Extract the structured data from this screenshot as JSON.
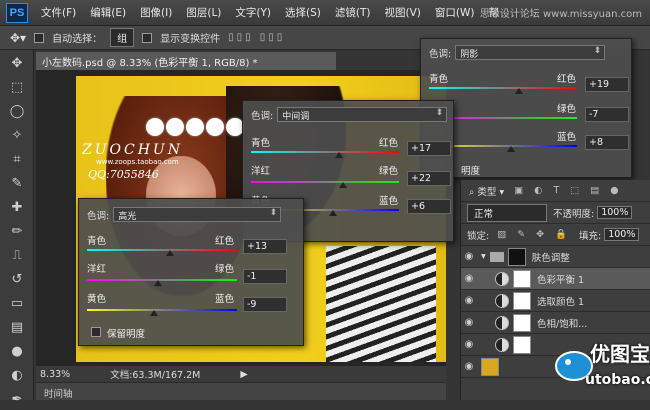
{
  "app": {
    "logo": "PS",
    "watermark_top": "思缘设计论坛 www.missyuan.com"
  },
  "menu": [
    "文件(F)",
    "编辑(E)",
    "图像(I)",
    "图层(L)",
    "文字(Y)",
    "选择(S)",
    "滤镜(T)",
    "视图(V)",
    "窗口(W)",
    "帮"
  ],
  "options": {
    "auto_select": "自动选择：",
    "group": "组",
    "show_transform": "显示变换控件"
  },
  "document": {
    "tab_title": "小左数码.psd @ 8.33% (色彩平衡 1, RGB/8) *",
    "zoom": "8.33%",
    "doc_size": "文档:63.3M/167.2M",
    "timeline": "时间轴"
  },
  "photo_text": {
    "brand": "ZUOCHUN",
    "url": "www.zoops.taobao.com",
    "qq": "QQ:7055846"
  },
  "labels": {
    "tone": "色调:",
    "cyan": "青色",
    "red": "红色",
    "magenta": "洋红",
    "green": "绿色",
    "yellow": "黄色",
    "blue": "蓝色",
    "preserve": "保留明度",
    "preserve_partial": "明度"
  },
  "panel_shadows": {
    "tone": "阴影",
    "cyan_red": "+19",
    "magenta_green": "-7",
    "yellow_blue": "+8"
  },
  "panel_midtones": {
    "tone": "中间调",
    "cyan_red": "+17",
    "magenta_green": "+22",
    "yellow_blue": "+6"
  },
  "panel_highlights": {
    "tone": "高光",
    "cyan_red": "+13",
    "magenta_green": "-1",
    "yellow_blue": "-9"
  },
  "layers": {
    "kind": "类型",
    "mode": "正常",
    "opacity_label": "不透明度:",
    "opacity": "100%",
    "lock_label": "锁定:",
    "fill_label": "填充:",
    "fill": "100%",
    "items": [
      "肤色调整",
      "色彩平衡 1",
      "选取颜色 1",
      "色相/饱和..."
    ]
  },
  "watermark": {
    "name": "优图宝",
    "url": "utobao.com"
  }
}
